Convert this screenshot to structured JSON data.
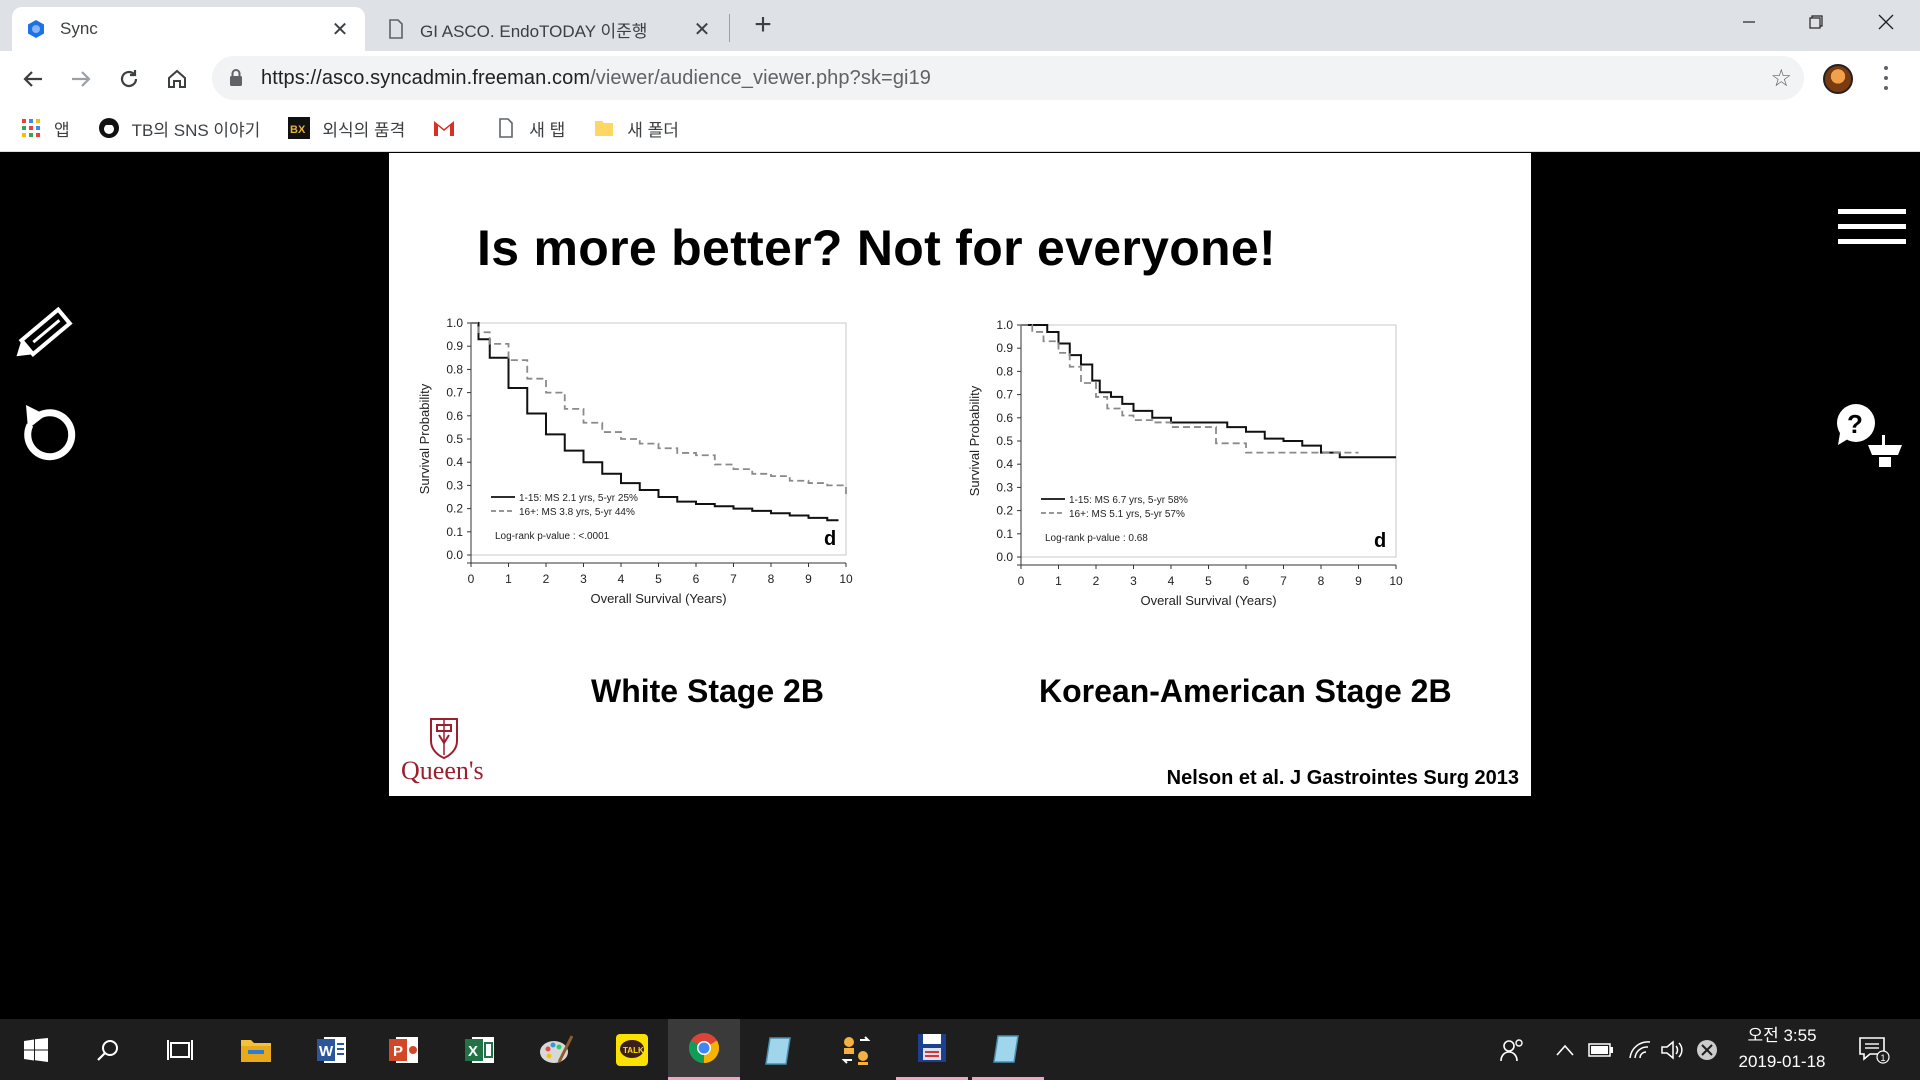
{
  "browser": {
    "tabs": [
      {
        "title": "Sync",
        "active": true
      },
      {
        "title": "GI ASCO. EndoTODAY 이준행",
        "active": false
      }
    ],
    "url_host": "https://asco.syncadmin.freeman.com",
    "url_path": "/viewer/audience_viewer.php?sk=gi19",
    "bookmarks": [
      {
        "label": "앱",
        "icon": "apps-grid-icon"
      },
      {
        "label": "TB의 SNS 이야기",
        "icon": "che-avatar-icon"
      },
      {
        "label": "외식의 품격",
        "icon": "bx-logo-icon"
      },
      {
        "label": "",
        "icon": "gmail-icon"
      },
      {
        "label": "새 탭",
        "icon": "page-icon"
      },
      {
        "label": "새 폴더",
        "icon": "folder-icon"
      }
    ]
  },
  "slide": {
    "title": "Is more better? Not for everyone!",
    "left_caption": "White Stage 2B",
    "right_caption": "Korean-American Stage 2B",
    "citation": "Nelson et al. J Gastrointes Surg 2013",
    "logo_text": "Queen's"
  },
  "chart_data": [
    {
      "type": "line",
      "xlabel": "Overall Survival (Years)",
      "ylabel": "Survival Probability",
      "xlim": [
        0,
        10
      ],
      "ylim": [
        0.0,
        1.0
      ],
      "xticks": [
        "0",
        "1",
        "2",
        "3",
        "4",
        "5",
        "6",
        "7",
        "8",
        "9",
        "10"
      ],
      "yticks": [
        "0.0",
        "0.1",
        "0.2",
        "0.3",
        "0.4",
        "0.5",
        "0.6",
        "0.7",
        "0.8",
        "0.9",
        "1.0"
      ],
      "panel_label": "d",
      "annotation": "Log-rank p-value : <.0001",
      "series": [
        {
          "name": "1-15: MS 2.1 yrs, 5-yr 25%",
          "style": "solid",
          "x": [
            0,
            0.2,
            0.5,
            1,
            1.5,
            2,
            2.5,
            3,
            3.5,
            4,
            4.5,
            5,
            5.5,
            6,
            6.5,
            7,
            7.5,
            8,
            8.5,
            9,
            9.5,
            9.8
          ],
          "y": [
            1.0,
            0.93,
            0.85,
            0.72,
            0.61,
            0.52,
            0.45,
            0.4,
            0.35,
            0.31,
            0.28,
            0.25,
            0.23,
            0.22,
            0.21,
            0.2,
            0.19,
            0.18,
            0.17,
            0.16,
            0.15,
            0.15
          ]
        },
        {
          "name": "16+: MS 3.8 yrs, 5-yr 44%",
          "style": "dashed",
          "x": [
            0,
            0.2,
            0.5,
            1,
            1.5,
            2,
            2.5,
            3,
            3.5,
            4,
            4.5,
            5,
            5.5,
            6,
            6.5,
            7,
            7.5,
            8,
            8.5,
            9,
            9.5,
            10
          ],
          "y": [
            1.0,
            0.96,
            0.91,
            0.84,
            0.76,
            0.7,
            0.63,
            0.57,
            0.53,
            0.5,
            0.48,
            0.46,
            0.44,
            0.43,
            0.39,
            0.37,
            0.35,
            0.34,
            0.32,
            0.31,
            0.3,
            0.25
          ]
        }
      ]
    },
    {
      "type": "line",
      "xlabel": "Overall Survival (Years)",
      "ylabel": "Survival Probability",
      "xlim": [
        0,
        10
      ],
      "ylim": [
        0.0,
        1.0
      ],
      "xticks": [
        "0",
        "1",
        "2",
        "3",
        "4",
        "5",
        "6",
        "7",
        "8",
        "9",
        "10"
      ],
      "yticks": [
        "0.0",
        "0.1",
        "0.2",
        "0.3",
        "0.4",
        "0.5",
        "0.6",
        "0.7",
        "0.8",
        "0.9",
        "1.0"
      ],
      "panel_label": "d",
      "annotation": "Log-rank p-value : 0.68",
      "series": [
        {
          "name": "1-15: MS 6.7 yrs, 5-yr 58%",
          "style": "solid",
          "x": [
            0,
            0.5,
            0.7,
            1,
            1.3,
            1.6,
            1.9,
            2.1,
            2.4,
            2.7,
            3,
            3.5,
            4,
            5,
            5.5,
            6,
            6.5,
            7,
            7.5,
            8,
            8.5,
            10
          ],
          "y": [
            1.0,
            1.0,
            0.97,
            0.92,
            0.87,
            0.83,
            0.76,
            0.71,
            0.69,
            0.66,
            0.63,
            0.6,
            0.58,
            0.58,
            0.56,
            0.54,
            0.51,
            0.5,
            0.48,
            0.45,
            0.43,
            0.43
          ]
        },
        {
          "name": "16+: MS 5.1 yrs, 5-yr 57%",
          "style": "dashed",
          "x": [
            0,
            0.3,
            0.6,
            1,
            1.3,
            1.6,
            2,
            2.3,
            2.7,
            3,
            3.5,
            4,
            4.5,
            5,
            5.2,
            5.5,
            6,
            7,
            8,
            8.5,
            9
          ],
          "y": [
            1.0,
            0.97,
            0.93,
            0.88,
            0.82,
            0.75,
            0.69,
            0.64,
            0.61,
            0.59,
            0.58,
            0.56,
            0.56,
            0.56,
            0.49,
            0.49,
            0.45,
            0.45,
            0.45,
            0.45,
            0.45
          ]
        }
      ]
    }
  ],
  "taskbar": {
    "apps": [
      "windows-start-icon",
      "search-icon",
      "task-view-icon",
      "file-explorer-icon",
      "word-icon",
      "powerpoint-icon",
      "excel-icon",
      "paint-icon",
      "kakaotalk-icon",
      "chrome-icon",
      "notepad-icon",
      "people-swap-icon",
      "floppy-app-icon",
      "notepad2-icon"
    ],
    "time": "오전 3:55",
    "date": "2019-01-18",
    "notification_count": "1"
  }
}
